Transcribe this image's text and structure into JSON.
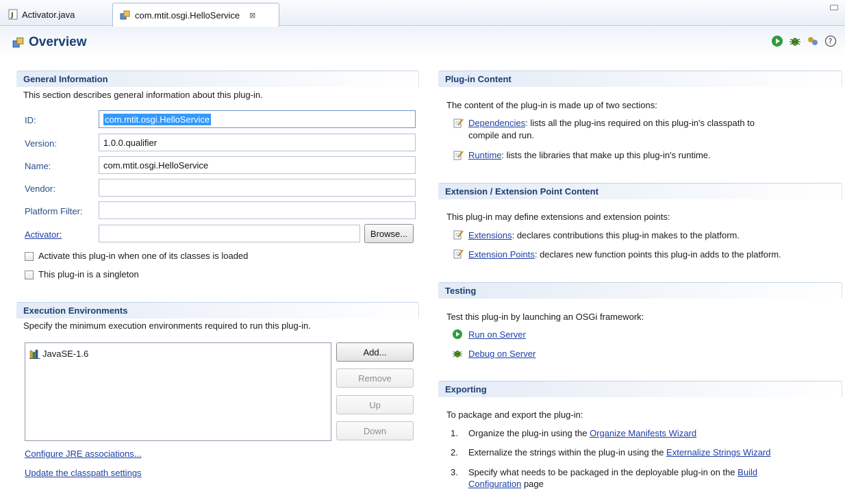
{
  "tabs": [
    {
      "label": "Activator.java",
      "active": false
    },
    {
      "label": "com.mtit.osgi.HelloService",
      "active": true,
      "close": "⊠"
    }
  ],
  "header": {
    "title": "Overview"
  },
  "general": {
    "title": "General Information",
    "description": "This section describes general information about this plug-in.",
    "id_label": "ID:",
    "id_value": "com.mtit.osgi.HelloService",
    "version_label": "Version:",
    "version_value": "1.0.0.qualifier",
    "name_label": "Name:",
    "name_value": "com.mtit.osgi.HelloService",
    "vendor_label": "Vendor:",
    "vendor_value": "",
    "platform_label": "Platform Filter:",
    "platform_value": "",
    "activator_label": "Activator:",
    "activator_value": "",
    "browse_label": "Browse...",
    "check_activate": "Activate this plug-in when one of its classes is loaded",
    "check_singleton": "This plug-in is a singleton"
  },
  "exec": {
    "title": "Execution Environments",
    "description": "Specify the minimum execution environments required to run this plug-in.",
    "items": [
      "JavaSE-1.6"
    ],
    "add": "Add...",
    "remove": "Remove",
    "up": "Up",
    "down": "Down",
    "configure_link": "Configure JRE associations...",
    "update_link": "Update the classpath settings"
  },
  "content": {
    "title": "Plug-in Content",
    "intro": "The content of the plug-in is made up of two sections:",
    "dep_link": "Dependencies",
    "dep_text_1": ": lists all the plug-ins required on this plug-in's classpath to",
    "dep_text_2": "compile and run.",
    "runtime_link": "Runtime",
    "runtime_text": ": lists the libraries that make up this plug-in's runtime."
  },
  "extension": {
    "title": "Extension / Extension Point Content",
    "intro": "This plug-in may define extensions and extension points:",
    "ext_link": "Extensions",
    "ext_text": ": declares contributions this plug-in makes to the platform.",
    "extpt_link": "Extension Points",
    "extpt_text": ": declares new function points this plug-in adds to the platform."
  },
  "testing": {
    "title": "Testing",
    "intro": "Test this plug-in by launching an OSGi framework:",
    "run_link": "Run on Server",
    "debug_link": "Debug on Server"
  },
  "exporting": {
    "title": "Exporting",
    "intro": "To package and export the plug-in:",
    "step1_num": "1.",
    "step1_text": "Organize the plug-in using the ",
    "step1_link": "Organize Manifests Wizard",
    "step2_num": "2.",
    "step2_text": "Externalize the strings within the plug-in using the ",
    "step2_link": "Externalize Strings Wizard",
    "step3_num": "3.",
    "step3_text": "Specify what needs to be packaged in the deployable plug-in on the ",
    "step3_link": "Build",
    "step3_link2": "Configuration",
    "step3_tail": " page"
  },
  "colors": {
    "section_title": "#1b3e74",
    "link": "#1d3fa6",
    "selection": "#3399ff"
  }
}
